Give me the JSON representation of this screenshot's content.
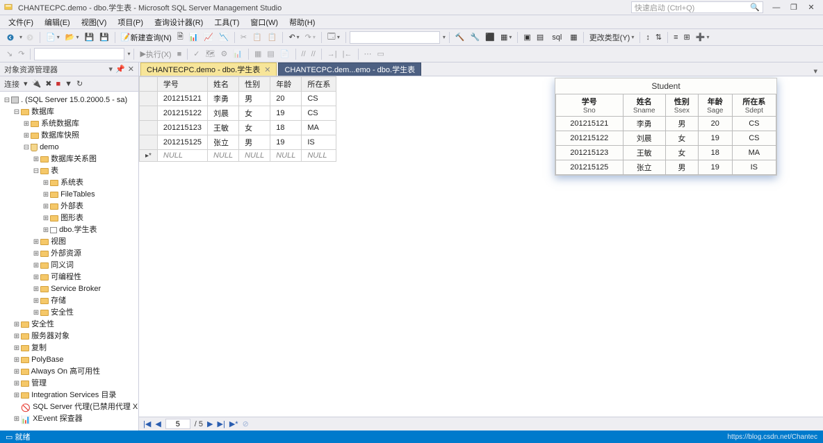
{
  "window": {
    "title": "CHANTECPC.demo - dbo.学生表 - Microsoft SQL Server Management Studio",
    "quick_launch_placeholder": "快速启动 (Ctrl+Q)"
  },
  "menu": [
    "文件(F)",
    "编辑(E)",
    "视图(V)",
    "项目(P)",
    "查询设计器(R)",
    "工具(T)",
    "窗口(W)",
    "帮助(H)"
  ],
  "toolbar": {
    "new_query": "新建查询(N)",
    "execute": "执行(X)",
    "change_type": "更改类型(Y)"
  },
  "sidebar": {
    "title": "对象资源管理器",
    "connect_label": "连接",
    "server": ". (SQL Server 15.0.2000.5 - sa)",
    "nodes": {
      "databases": "数据库",
      "sys_db": "系统数据库",
      "db_snapshot": "数据库快照",
      "demo": "demo",
      "db_diagram": "数据库关系图",
      "tables": "表",
      "sys_tables": "系统表",
      "filetables": "FileTables",
      "external_tables": "外部表",
      "graph_tables": "图形表",
      "student_table": "dbo.学生表",
      "views": "视图",
      "ext_resource": "外部资源",
      "synonyms": "同义词",
      "programmability": "可编程性",
      "service_broker": "Service Broker",
      "storage": "存储",
      "security_db": "安全性",
      "security": "安全性",
      "server_objects": "服务器对象",
      "replication": "复制",
      "polybase": "PolyBase",
      "always_on": "Always On 高可用性",
      "management": "管理",
      "integration": "Integration Services 目录",
      "sql_agent": "SQL Server 代理(已禁用代理 XP)",
      "xevent": "XEvent 探查器"
    }
  },
  "tabs": [
    {
      "label": "CHANTECPC.demo - dbo.学生表",
      "active": true
    },
    {
      "label": "CHANTECPC.dem...emo - dbo.学生表",
      "active": false
    }
  ],
  "grid": {
    "columns": [
      "学号",
      "姓名",
      "性别",
      "年龄",
      "所在系"
    ],
    "rows": [
      [
        "201215121",
        "李勇",
        "男",
        "20",
        "CS"
      ],
      [
        "201215122",
        "刘晨",
        "女",
        "19",
        "CS"
      ],
      [
        "201215123",
        "王敏",
        "女",
        "18",
        "MA"
      ],
      [
        "201215125",
        "张立",
        "男",
        "19",
        "IS"
      ]
    ],
    "null_row_marker": "▸*",
    "null_text": "NULL"
  },
  "float": {
    "title": "Student",
    "headers": [
      {
        "cn": "学号",
        "en": "Sno"
      },
      {
        "cn": "姓名",
        "en": "Sname"
      },
      {
        "cn": "性别",
        "en": "Ssex"
      },
      {
        "cn": "年龄",
        "en": "Sage"
      },
      {
        "cn": "所在系",
        "en": "Sdept"
      }
    ],
    "rows": [
      [
        "201215121",
        "李勇",
        "男",
        "20",
        "CS"
      ],
      [
        "201215122",
        "刘晨",
        "女",
        "19",
        "CS"
      ],
      [
        "201215123",
        "王敏",
        "女",
        "18",
        "MA"
      ],
      [
        "201215125",
        "张立",
        "男",
        "19",
        "IS"
      ]
    ]
  },
  "paginator": {
    "current": "5",
    "total": "/ 5"
  },
  "status": {
    "ready": "就绪",
    "url": "https://blog.csdn.net/Chantec"
  }
}
